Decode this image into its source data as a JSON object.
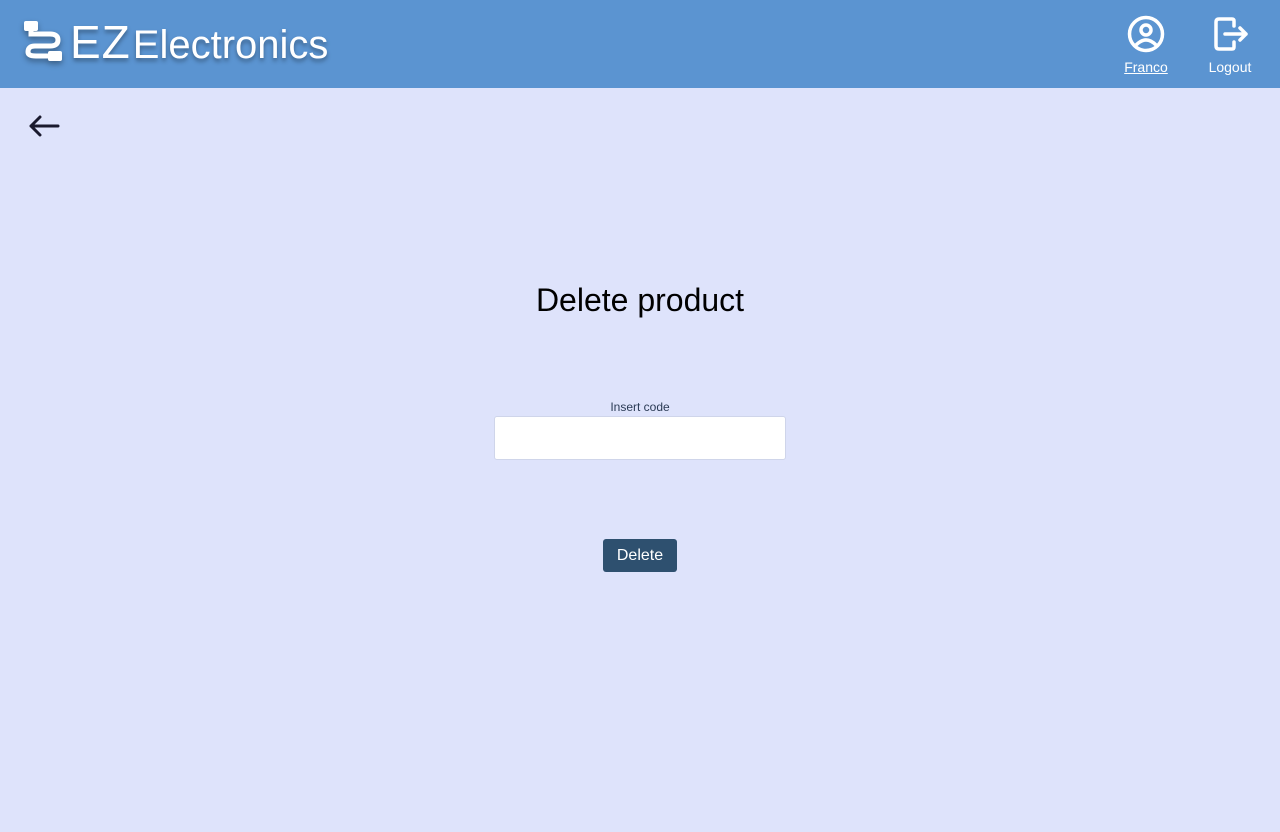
{
  "header": {
    "brand_prefix": "EZ",
    "brand_suffix": "Electronics",
    "logo_icon": "cable-connector-icon",
    "user": {
      "name": "Franco",
      "icon": "user-circle-icon"
    },
    "logout": {
      "label": "Logout",
      "icon": "logout-icon"
    },
    "background_color": "#5b94d1"
  },
  "nav": {
    "back_icon": "arrow-left-icon"
  },
  "main": {
    "title": "Delete product",
    "code_field": {
      "label": "Insert code",
      "value": "",
      "placeholder": ""
    },
    "delete_button": "Delete",
    "background_color": "#dee3fb",
    "button_color": "#2e506f"
  }
}
